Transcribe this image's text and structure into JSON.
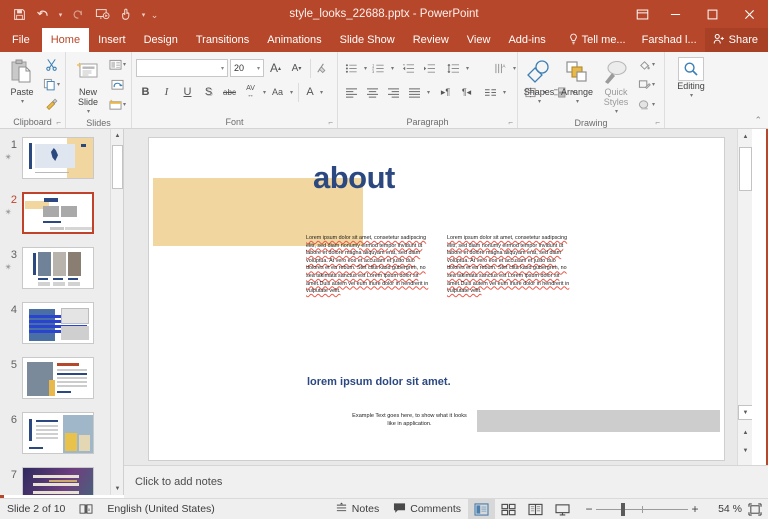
{
  "window": {
    "title": "style_looks_22688.pptx - PowerPoint",
    "quick_access": [
      {
        "name": "save-icon",
        "glyph": "ὋE"
      },
      {
        "name": "undo-icon",
        "glyph": "↶"
      },
      {
        "name": "redo-icon",
        "glyph": "↻"
      },
      {
        "name": "start-presentation-icon",
        "glyph": "▷"
      },
      {
        "name": "touch-mode-icon",
        "glyph": "☝"
      },
      {
        "name": "customize-quick-access-toolbar-icon",
        "glyph": "≡"
      }
    ],
    "controls": {
      "ribbon_display_options": "⬒",
      "minimize": "─",
      "maximize": "☐",
      "close": "✕"
    }
  },
  "tabs": [
    {
      "label": "File",
      "active": false
    },
    {
      "label": "Home",
      "active": true
    },
    {
      "label": "Insert",
      "active": false
    },
    {
      "label": "Design",
      "active": false
    },
    {
      "label": "Transitions",
      "active": false
    },
    {
      "label": "Animations",
      "active": false
    },
    {
      "label": "Slide Show",
      "active": false
    },
    {
      "label": "Review",
      "active": false
    },
    {
      "label": "View",
      "active": false
    },
    {
      "label": "Add-ins",
      "active": false
    }
  ],
  "tabbar_right": {
    "tell_me": "Tell me...",
    "account": "Farshad l...",
    "share": "Share"
  },
  "ribbon": {
    "groups": [
      {
        "label": "Clipboard"
      },
      {
        "label": "Slides"
      },
      {
        "label": "Font"
      },
      {
        "label": "Paragraph"
      },
      {
        "label": "Drawing"
      },
      {
        "label": "Editing"
      }
    ],
    "clipboard": {
      "paste_label": "Paste",
      "cut_icon": "✂",
      "copy_icon": "⧉",
      "format_painter_icon": "὘C"
    },
    "slides": {
      "new_slide_label": "New Slide",
      "layout_icon": "☷",
      "reset_icon": "↺",
      "section_icon": "▤"
    },
    "font": {
      "font_name_value": "",
      "font_size_value": "20",
      "grow_font": "A",
      "shrink_font": "A",
      "clear_formatting": "✐",
      "bold": "B",
      "italic": "I",
      "underline": "U",
      "shadow": "S",
      "strikethrough": "abc",
      "character_spacing": "AV",
      "change_case": "Aa",
      "font_color": "A"
    },
    "paragraph": {
      "bullets": "☰",
      "numbering": "☲",
      "decrease_indent": "⇤",
      "increase_indent": "⇥",
      "line_spacing": "↕",
      "align_left": "≡",
      "align_center": "≡",
      "align_right": "≡",
      "justify": "≡",
      "columns": "≣",
      "text_direction": "▶¶",
      "align_text": "¶◀",
      "convert_to_smartart": "≣",
      "text_direction_v": "A",
      "align_text_box": "⬍",
      "smartart": "▣"
    },
    "drawing": {
      "shapes_label": "Shapes",
      "arrange_label": "Arrange",
      "quick_styles_label": "Quick Styles",
      "shape_fill": "὘C",
      "shape_outline": "✏",
      "shape_effects": "◑"
    },
    "editing": {
      "editing_label": "Editing",
      "find_icon": "ὐD"
    },
    "collapse_ribbon": "⌃"
  },
  "thumbnails": {
    "selected_index": 2,
    "items": [
      {
        "number": "1",
        "star": "✴",
        "kind": "style-cover"
      },
      {
        "number": "2",
        "star": "✴",
        "kind": "about"
      },
      {
        "number": "3",
        "star": "✴",
        "kind": "three-photos"
      },
      {
        "number": "4",
        "star": "",
        "kind": "blue-text-photo"
      },
      {
        "number": "5",
        "star": "",
        "kind": "trend-story"
      },
      {
        "number": "6",
        "star": "",
        "kind": "yellow-photo"
      },
      {
        "number": "7",
        "star": "",
        "kind": "slogan"
      }
    ],
    "scroll_up_icon": "▲",
    "scroll_down_icon": "▼"
  },
  "slide": {
    "title": "about",
    "body_text": "Lorem ipsum dolor sit amet, consetetur sadipscing elitr, sed diam nonumy eirmod tempor invidunt ut labore et dolore magna aliquyam erat, sed diam voluptua. At vero eos et accusam et justo duo dolores et ea rebum. Stet clita kasd gubergren, no sea takimata sanctus est Lorem ipsum dolor sit amet.Duis autem vel eum iriure dolor in hendrerit in vulputate velit.",
    "subtitle": "lorem ipsum dolor sit amet.",
    "example_note": "Example Text goes here, to show what it looks like in application.",
    "colors": {
      "title_blue": "#2c4881",
      "accent_yellow": "#f1d79f",
      "gray_bar": "#cdcdcd"
    }
  },
  "notes": {
    "placeholder": "Click to add notes"
  },
  "status_bar": {
    "slide_counter": "Slide 2 of 10",
    "spellcheck_icon": "Ὅ6",
    "language": "English (United States)",
    "notes_label": "Notes",
    "notes_icon": "≡",
    "comments_label": "Comments",
    "comments_icon": "὞8",
    "views": [
      {
        "name": "normal-view",
        "icon": "▥",
        "active": true
      },
      {
        "name": "slide-sorter-view",
        "icon": "☷",
        "active": false
      },
      {
        "name": "reading-view",
        "icon": "Ὅ6",
        "active": false
      },
      {
        "name": "slide-show-view",
        "icon": "὚5",
        "active": false
      }
    ],
    "zoom_out": "−",
    "zoom_in": "+",
    "zoom_value": "54 %",
    "fit_slide_icon": "⛶"
  }
}
